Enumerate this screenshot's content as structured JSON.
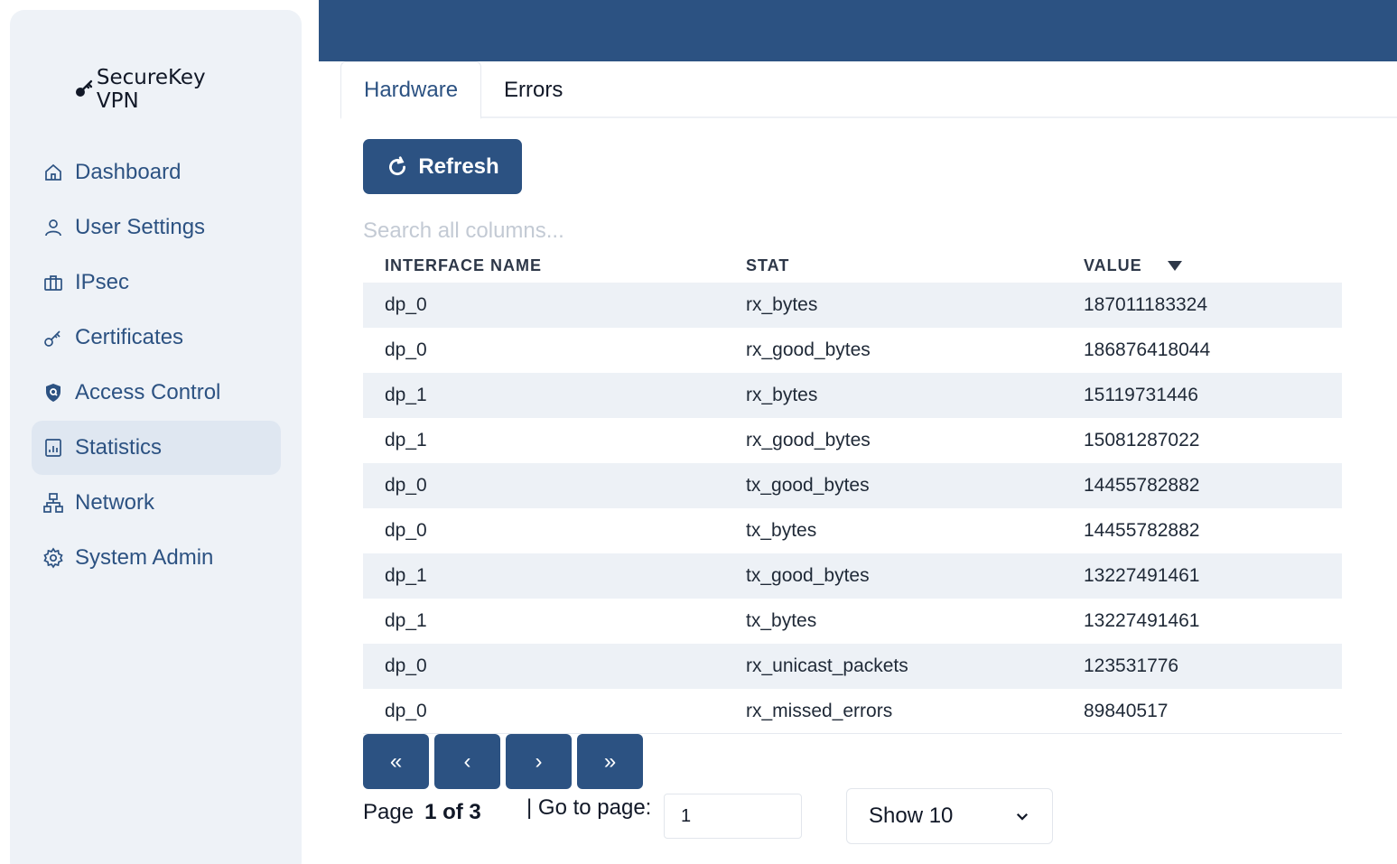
{
  "brand": {
    "name": "SecureKey VPN",
    "icon": "key-icon"
  },
  "sidebar": {
    "items": [
      {
        "label": "Dashboard",
        "icon": "home-icon"
      },
      {
        "label": "User Settings",
        "icon": "user-icon"
      },
      {
        "label": "IPsec",
        "icon": "briefcase-icon"
      },
      {
        "label": "Certificates",
        "icon": "key-icon"
      },
      {
        "label": "Access Control",
        "icon": "shield-icon"
      },
      {
        "label": "Statistics",
        "icon": "chart-icon",
        "active": true
      },
      {
        "label": "Network",
        "icon": "network-icon"
      },
      {
        "label": "System Admin",
        "icon": "gear-icon"
      }
    ]
  },
  "tabs": [
    {
      "label": "Hardware",
      "active": true
    },
    {
      "label": "Errors",
      "active": false
    }
  ],
  "toolbar": {
    "refresh_label": "Refresh"
  },
  "search": {
    "placeholder": "Search all columns..."
  },
  "table": {
    "columns": [
      "INTERFACE NAME",
      "STAT",
      "VALUE"
    ],
    "sorted_by": "VALUE",
    "rows": [
      [
        "dp_0",
        "rx_bytes",
        "187011183324"
      ],
      [
        "dp_0",
        "rx_good_bytes",
        "186876418044"
      ],
      [
        "dp_1",
        "rx_bytes",
        "15119731446"
      ],
      [
        "dp_1",
        "rx_good_bytes",
        "15081287022"
      ],
      [
        "dp_0",
        "tx_good_bytes",
        "14455782882"
      ],
      [
        "dp_0",
        "tx_bytes",
        "14455782882"
      ],
      [
        "dp_1",
        "tx_good_bytes",
        "13227491461"
      ],
      [
        "dp_1",
        "tx_bytes",
        "13227491461"
      ],
      [
        "dp_0",
        "rx_unicast_packets",
        "123531776"
      ],
      [
        "dp_0",
        "rx_missed_errors",
        "89840517"
      ]
    ]
  },
  "pagination": {
    "first": "«",
    "prev": "‹",
    "next": "›",
    "last": "»",
    "page_label": "Page",
    "page_status": "1 of 3",
    "goto_label": "| Go to page:",
    "goto_value": "1",
    "show_label": "Show 10"
  },
  "colors": {
    "primary": "#2c5282",
    "sidebar_bg": "#eef2f7",
    "row_alt": "#edf1f6"
  }
}
